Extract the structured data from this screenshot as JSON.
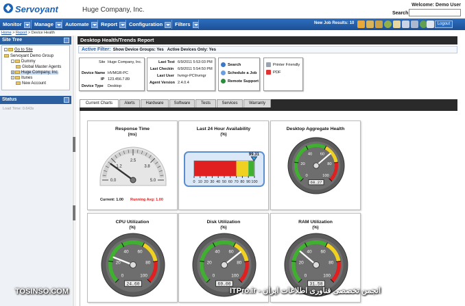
{
  "header": {
    "logo_text": "Servoyant",
    "company": "Huge Company, Inc.",
    "welcome": "Welcome: Demo User",
    "search_label": "Search:",
    "search_value": ""
  },
  "nav": {
    "items": [
      "Monitor",
      "Manage",
      "Automate",
      "Report",
      "Configuration",
      "Filters"
    ],
    "new_job_label": "New Job Results:",
    "new_job_count": "10",
    "logout": "Logout"
  },
  "breadcrumb": {
    "home": "Home",
    "report": "Report",
    "current": "Device Health"
  },
  "sidebar": {
    "site_tree_title": "Site Tree",
    "status_title": "Status",
    "goto_site": "Go to Site",
    "tree": [
      "Servoyant Demo Group",
      "Dummy",
      "Global Master Agents",
      "Huge Company, Inc.",
      "Itunes",
      "New Account"
    ],
    "load_time": "Load Time: 0.643s"
  },
  "report": {
    "title": "Desktop Health/Trends Report",
    "filter_label": "Active Filter:",
    "filter_groups": "Show Device Groups: Yes",
    "filter_active": "Active Devices Only: Yes"
  },
  "device": {
    "site_label": "Site",
    "site_value": "Huge Company, Inc.",
    "name_label": "Device Name",
    "name_value": "HVMGR-PC",
    "ip_label": "IP",
    "ip_value": "123.456.7.89",
    "type_label": "Device Type",
    "type_value": "Desktop"
  },
  "timing": {
    "last_test_label": "Last Test",
    "last_test": "6/9/2011 5:53:03 PM",
    "last_checkin_label": "Last Checkin",
    "last_checkin": "6/9/2011 5:54:50 PM",
    "last_user_label": "Last User",
    "last_user": "hvmgr-PC\\hvmgr",
    "agent_label": "Agent Version",
    "agent_version": "2.4.0.4"
  },
  "actions": {
    "search": "Search",
    "schedule": "Schedule a Job",
    "remote": "Remote Support",
    "printer": "Printer Friendly",
    "pdf": "PDF"
  },
  "tabs": [
    "Current Charts",
    "Alerts",
    "Hardware",
    "Software",
    "Tests",
    "Services",
    "Warranty"
  ],
  "cards": {
    "response": {
      "title": "Response Time",
      "unit": "(ms)",
      "ticks": [
        "0.0",
        "1.2",
        "2.5",
        "3.8",
        "5.0"
      ],
      "current_label": "Current:",
      "current": "1.00",
      "avg_label": "Running Avg:",
      "avg": "1.00",
      "value": 1.0,
      "max": 5.0
    },
    "availability": {
      "title": "Last 24 Hour Availability",
      "unit": "(%)",
      "value": 99.31,
      "value_label": "99.31",
      "ticks": [
        "0",
        "10",
        "20",
        "30",
        "40",
        "50",
        "60",
        "70",
        "80",
        "90",
        "100"
      ]
    },
    "aggregate": {
      "title": "Desktop Aggregate Health",
      "unit": "",
      "value": 68.27,
      "value_label": "68.27",
      "ticks": [
        "0",
        "20",
        "40",
        "60",
        "80",
        "100"
      ]
    },
    "cpu": {
      "title": "CPU Utilization",
      "unit": "(%)",
      "value": 24.6,
      "value_label": "24.60",
      "ticks": [
        "0",
        "20",
        "40",
        "60",
        "80",
        "100"
      ]
    },
    "disk": {
      "title": "Disk Utilization",
      "unit": "(%)",
      "value": 69.0,
      "value_label": "69.00",
      "ticks": [
        "0",
        "20",
        "40",
        "60",
        "80",
        "100"
      ]
    },
    "ram": {
      "title": "RAM Utilization",
      "unit": "(%)",
      "value": 31.58,
      "value_label": "31.58",
      "ticks": [
        "0",
        "20",
        "40",
        "60",
        "80",
        "100"
      ]
    }
  },
  "watermark": {
    "left": "TOSINSO.COM",
    "right": "ITPro.ir - انجمن تخصصی فناوری اطلاعات ایران"
  },
  "colors": {
    "nav": "#2d6fc0",
    "dark": "#2a2a2a",
    "red": "#e02020",
    "yellow": "#f0d020",
    "green": "#40b030"
  }
}
